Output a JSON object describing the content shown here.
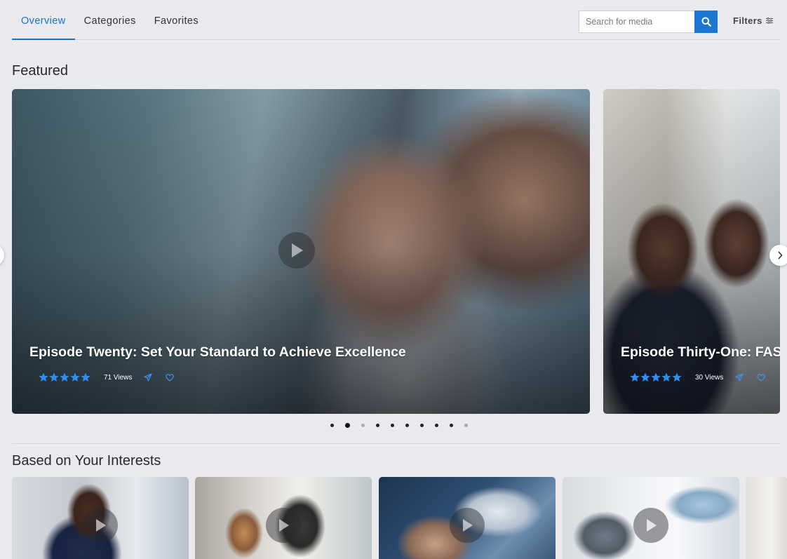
{
  "nav": {
    "tabs": [
      {
        "label": "Overview",
        "active": true
      },
      {
        "label": "Categories",
        "active": false
      },
      {
        "label": "Favorites",
        "active": false
      }
    ],
    "search": {
      "placeholder": "Search for media",
      "value": "",
      "button_icon": "search-icon"
    },
    "filters_label": "Filters",
    "filters_icon": "sliders-icon"
  },
  "featured": {
    "title": "Featured",
    "slides": [
      {
        "title": "Episode Twenty: Set Your Standard to Achieve Excellence",
        "rating": 5,
        "views": "71 Views",
        "icons": [
          "share-icon",
          "heart-icon"
        ]
      },
      {
        "title": "Episode Thirty-One: FASC",
        "rating": 5,
        "views": "30 Views",
        "icons": [
          "share-icon",
          "heart-icon"
        ]
      }
    ],
    "page_count": 10,
    "active_page": 2
  },
  "interests": {
    "title": "Based on Your Interests",
    "card_count": 5
  },
  "colors": {
    "accent": "#1a73c7",
    "search_button": "#1a78d2",
    "star": "#2f8ef0",
    "background": "#e9e9ee"
  }
}
